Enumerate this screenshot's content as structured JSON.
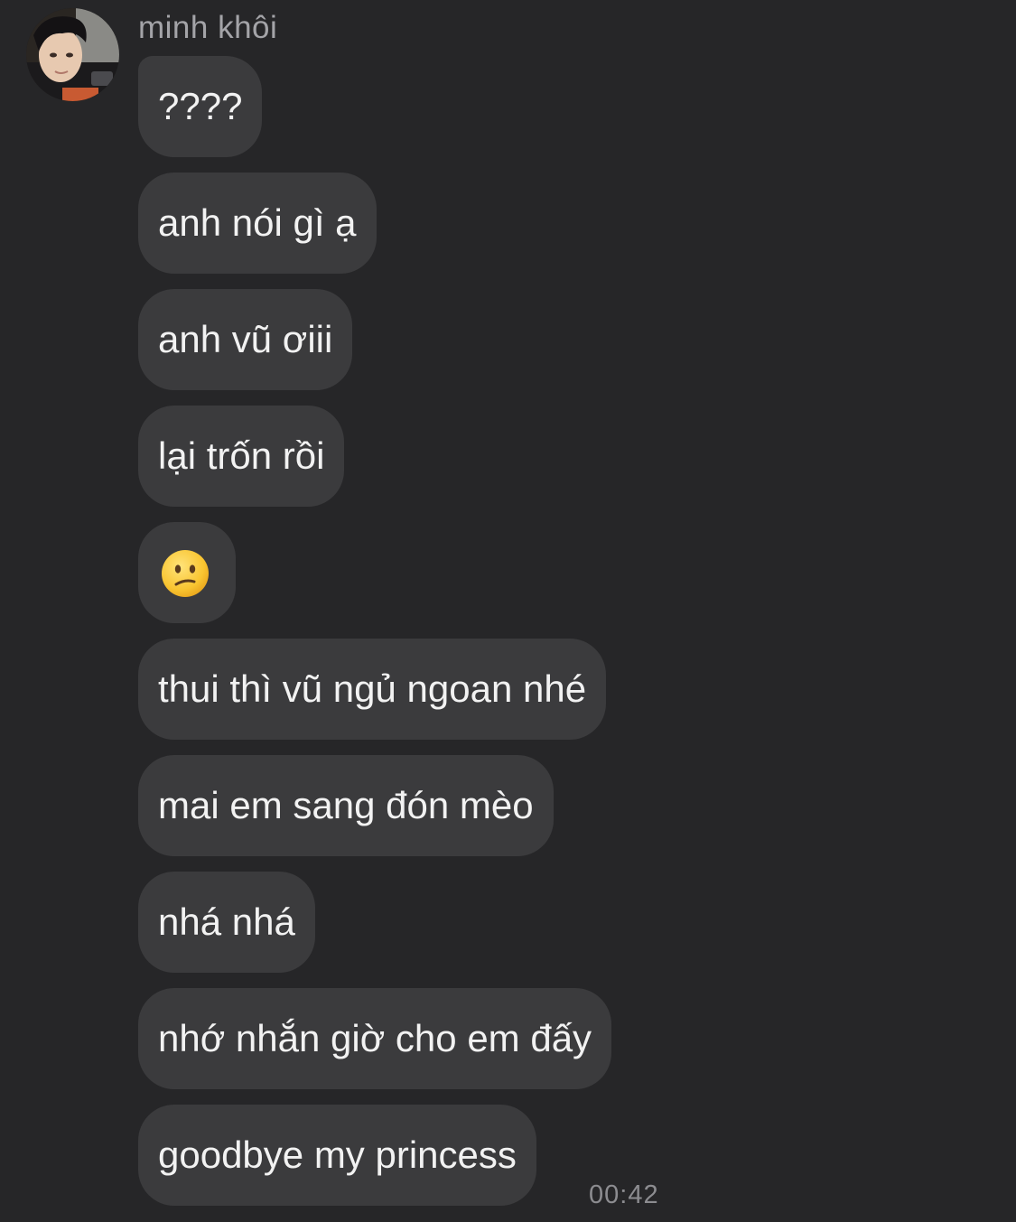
{
  "chat": {
    "sender_name": "minh khôi",
    "avatar": "contact-profile-photo",
    "messages": [
      {
        "text": "????"
      },
      {
        "text": "anh nói gì ạ"
      },
      {
        "text": "anh vũ ơiii"
      },
      {
        "text": "lại trốn rồi"
      },
      {
        "emoji": "confused-face-emoji"
      },
      {
        "text": "thui thì vũ ngủ ngoan nhé"
      },
      {
        "text": "mai em sang đón mèo"
      },
      {
        "text": "nhá nhá"
      },
      {
        "text": "nhớ nhắn giờ cho em đấy"
      },
      {
        "text": "goodbye my princess"
      }
    ],
    "timestamp": "00:42"
  },
  "colors": {
    "background": "#262628",
    "bubble": "#3b3b3d",
    "text": "#f2f2f2",
    "muted": "#a4a4a8"
  }
}
